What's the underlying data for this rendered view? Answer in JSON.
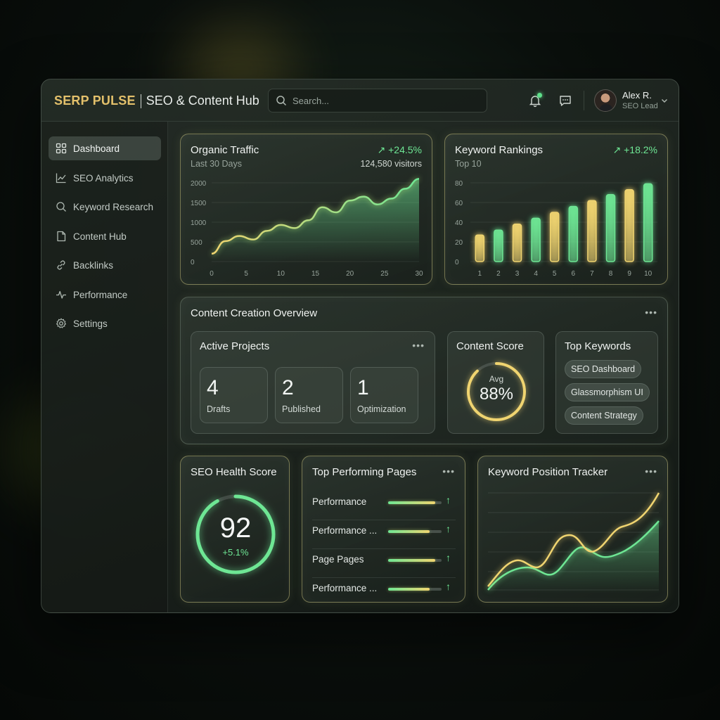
{
  "brand": {
    "name": "SERP PULSE",
    "subtitle": "SEO & Content Hub"
  },
  "search": {
    "placeholder": "Search..."
  },
  "user": {
    "name": "Alex R.",
    "role": "SEO Lead"
  },
  "sidebar": {
    "items": [
      {
        "label": "Dashboard",
        "icon": "dashboard-icon",
        "active": true
      },
      {
        "label": "SEO Analytics",
        "icon": "analytics-icon"
      },
      {
        "label": "Keyword Research",
        "icon": "search-icon"
      },
      {
        "label": "Content Hub",
        "icon": "document-icon"
      },
      {
        "label": "Backlinks",
        "icon": "link-icon"
      },
      {
        "label": "Performance",
        "icon": "pulse-icon"
      },
      {
        "label": "Settings",
        "icon": "gear-icon"
      }
    ]
  },
  "organic_traffic": {
    "title": "Organic Traffic",
    "subtitle": "Last 30 Days",
    "change": "+24.5%",
    "visitors": "124,580 visitors",
    "chart_data": {
      "type": "area",
      "x": [
        0,
        2,
        4,
        6,
        8,
        10,
        12,
        14,
        16,
        18,
        20,
        22,
        24,
        26,
        28,
        30
      ],
      "values": [
        200,
        520,
        650,
        560,
        780,
        930,
        850,
        1050,
        1380,
        1250,
        1550,
        1650,
        1450,
        1600,
        1850,
        2100
      ],
      "ylim": [
        0,
        2000
      ],
      "yticks": [
        "2000",
        "1500",
        "1000",
        "500",
        "0"
      ],
      "xticks": [
        "0",
        "5",
        "10",
        "15",
        "20",
        "25",
        "30"
      ]
    }
  },
  "keyword_rankings": {
    "title": "Keyword Rankings",
    "subtitle": "Top 10",
    "change": "+18.2%",
    "chart_data": {
      "type": "bar",
      "categories": [
        "1",
        "2",
        "3",
        "4",
        "5",
        "6",
        "7",
        "8",
        "9",
        "10"
      ],
      "values": [
        27,
        32,
        38,
        44,
        50,
        56,
        62,
        68,
        73,
        79
      ],
      "ylim": [
        0,
        80
      ],
      "yticks": [
        "80",
        "60",
        "40",
        "20",
        "0"
      ]
    }
  },
  "content_overview": {
    "title": "Content Creation Overview",
    "active_projects": {
      "title": "Active Projects",
      "stats": [
        {
          "value": "4",
          "label": "Drafts"
        },
        {
          "value": "2",
          "label": "Published"
        },
        {
          "value": "1",
          "label": "Optimization"
        }
      ]
    },
    "content_score": {
      "title": "Content Score",
      "label": "Avg",
      "value": "88%",
      "fraction": 0.88
    },
    "top_keywords": {
      "title": "Top Keywords",
      "chips": [
        "SEO Dashboard",
        "Glassmorphism UI",
        "Content Strategy"
      ]
    }
  },
  "seo_health": {
    "title": "SEO Health Score",
    "value": "92",
    "change": "+5.1%",
    "fraction": 0.92
  },
  "top_pages": {
    "title": "Top Performing Pages",
    "rows": [
      {
        "label": "Performance",
        "progress": 0.88,
        "arrow": "↑"
      },
      {
        "label": "Performance ...",
        "progress": 0.78,
        "arrow": "↑"
      },
      {
        "label": "Page Pages",
        "progress": 0.88,
        "arrow": "↑"
      },
      {
        "label": "Performance ...",
        "progress": 0.78,
        "arrow": "↑"
      }
    ]
  },
  "position_tracker": {
    "title": "Keyword Position Tracker"
  },
  "colors": {
    "accent_green": "#6ee694",
    "accent_gold": "#f0d470",
    "brand_gold": "#e3c06b"
  }
}
